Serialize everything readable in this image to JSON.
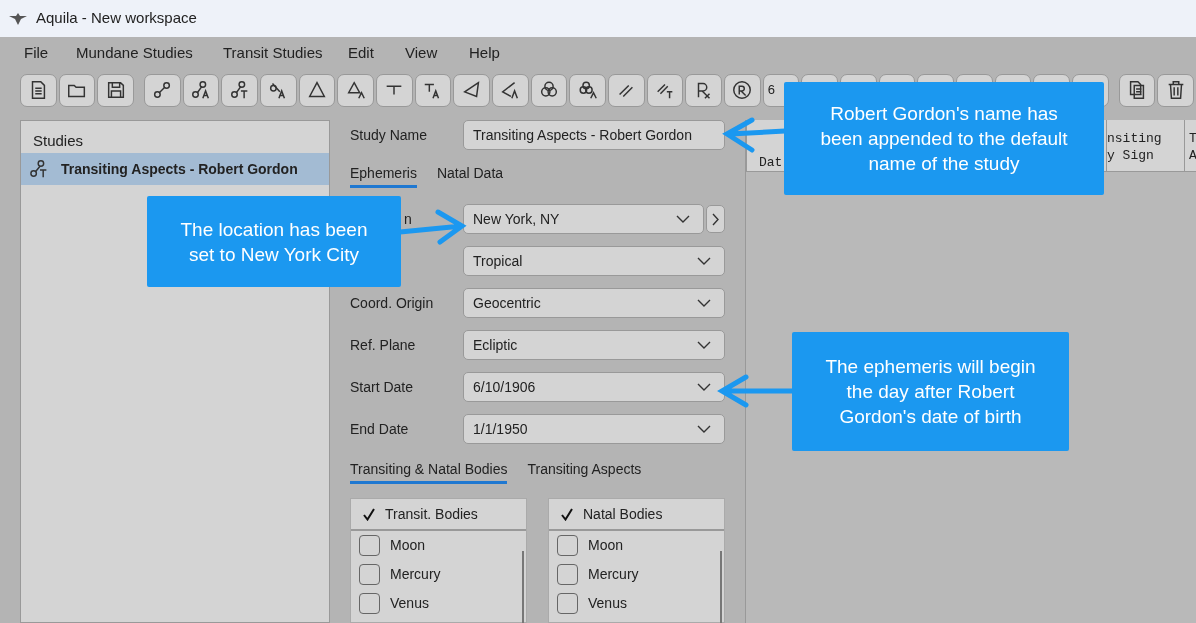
{
  "window": {
    "title": "Aquila - New workspace"
  },
  "menu": [
    "File",
    "Mundane Studies",
    "Transit Studies",
    "Edit",
    "View",
    "Help"
  ],
  "toolbar": {
    "number_label": "6"
  },
  "studies": {
    "title": "Studies",
    "items": [
      {
        "label": "Transiting Aspects - Robert Gordon",
        "selected": true
      }
    ]
  },
  "form": {
    "study_name_label": "Study Name",
    "study_name": "Transiting Aspects - Robert Gordon",
    "tabs": [
      {
        "label": "Ephemeris",
        "selected": true
      },
      {
        "label": "Natal Data",
        "selected": false
      }
    ],
    "fields": [
      {
        "kind": "location",
        "label": "n",
        "value": "New York, NY"
      },
      {
        "kind": "dropdown",
        "value": "Tropical"
      },
      {
        "kind": "dropdown",
        "label": "Coord. Origin",
        "value": "Geocentric"
      },
      {
        "kind": "dropdown",
        "label": "Ref. Plane",
        "value": "Ecliptic"
      },
      {
        "kind": "dropdown",
        "label": "Start Date",
        "value": "6/10/1906"
      },
      {
        "kind": "dropdown",
        "label": "End Date",
        "value": "1/1/1950"
      }
    ],
    "body_tabs": [
      {
        "label": "Transiting & Natal Bodies",
        "selected": true
      },
      {
        "label": "Transiting Aspects",
        "selected": false
      }
    ],
    "lists": [
      {
        "header": "Transit. Bodies",
        "checked": true,
        "items": [
          {
            "label": "Moon",
            "checked": false
          },
          {
            "label": "Mercury",
            "checked": false
          },
          {
            "label": "Venus",
            "checked": false
          }
        ]
      },
      {
        "header": "Natal Bodies",
        "checked": true,
        "items": [
          {
            "label": "Moon",
            "checked": false
          },
          {
            "label": "Mercury",
            "checked": false
          },
          {
            "label": "Venus",
            "checked": false
          }
        ]
      }
    ]
  },
  "results": {
    "columns": [
      {
        "lines": [
          "Dat"
        ]
      },
      {
        "lines": [
          "nsiting",
          "y Sign"
        ]
      },
      {
        "lines": [
          "T",
          "A"
        ]
      }
    ]
  },
  "callouts": [
    {
      "text": "Robert Gordon's name has been appended to the default name of the study"
    },
    {
      "text": "The location has been set to New York City"
    },
    {
      "text": "The ephemeris will begin the day after Robert Gordon's date of birth"
    }
  ]
}
